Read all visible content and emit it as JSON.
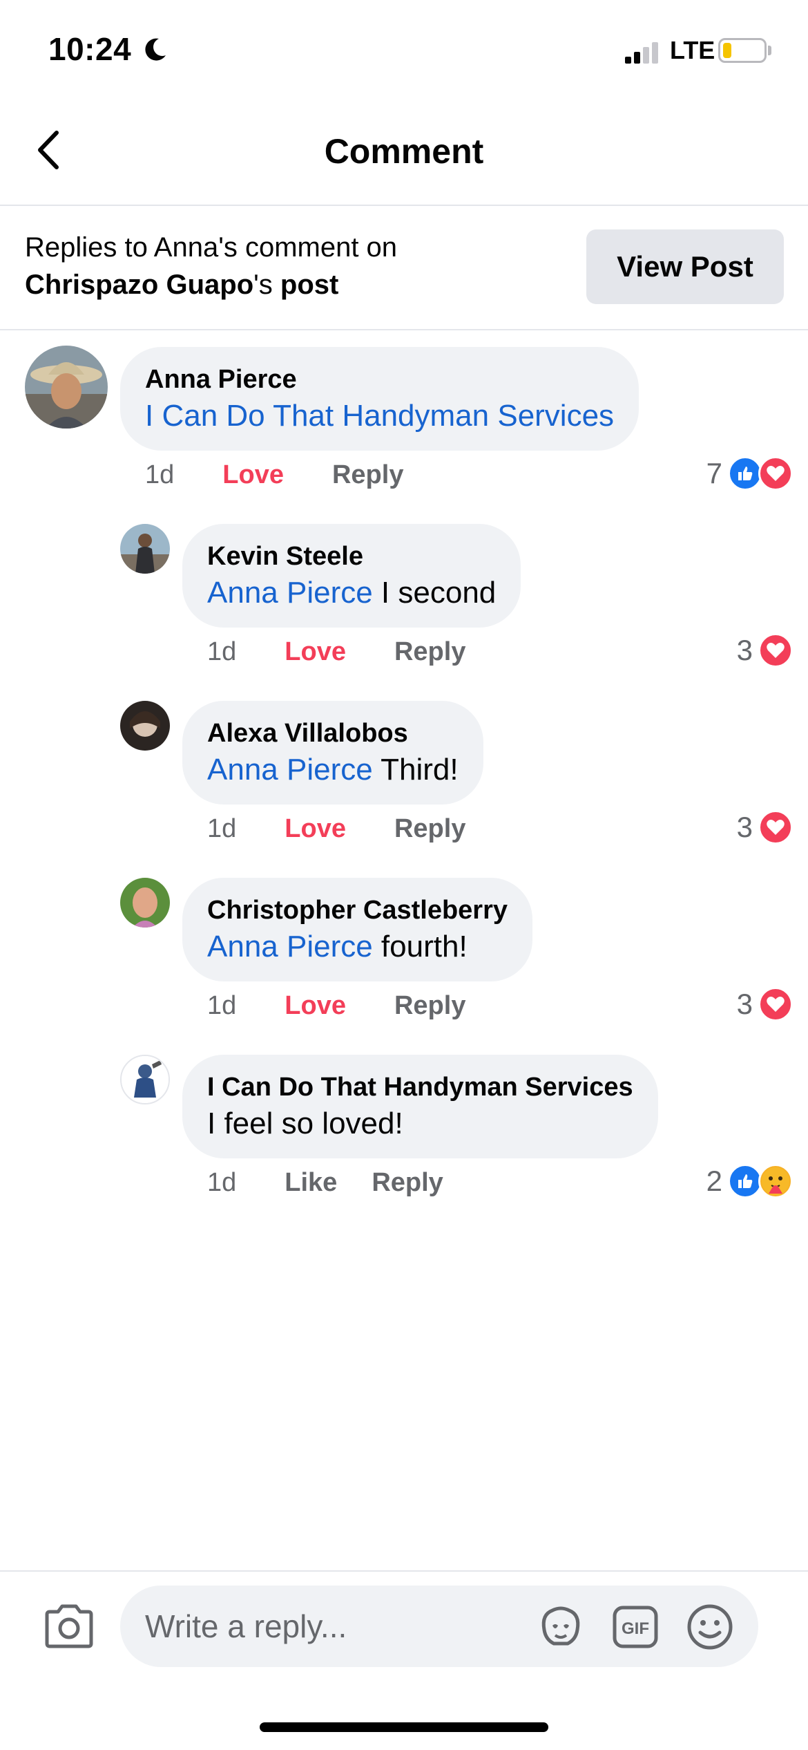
{
  "status_bar": {
    "time": "10:24",
    "network": "LTE"
  },
  "header": {
    "title": "Comment"
  },
  "context": {
    "line1": "Replies to Anna's comment on",
    "post_owner": "Chrispazo Guapo",
    "possessive": "'s",
    "post_word": "post",
    "view_post_label": "View Post"
  },
  "comments": [
    {
      "author": "Anna Pierce",
      "mention": "",
      "text": "I Can Do That Handyman Services",
      "time": "1d",
      "reaction_action": "Love",
      "reply_label": "Reply",
      "reaction_count": "7",
      "reactions": [
        "like-icon",
        "love-icon"
      ]
    },
    {
      "author": "Kevin Steele",
      "mention": "Anna Pierce",
      "text": " I second",
      "time": "1d",
      "reaction_action": "Love",
      "reply_label": "Reply",
      "reaction_count": "3",
      "reactions": [
        "love-icon"
      ]
    },
    {
      "author": "Alexa Villalobos",
      "mention": "Anna Pierce",
      "text": " Third!",
      "time": "1d",
      "reaction_action": "Love",
      "reply_label": "Reply",
      "reaction_count": "3",
      "reactions": [
        "love-icon"
      ]
    },
    {
      "author": "Christopher Castleberry",
      "mention": "Anna Pierce",
      "text": " fourth!",
      "time": "1d",
      "reaction_action": "Love",
      "reply_label": "Reply",
      "reaction_count": "3",
      "reactions": [
        "love-icon"
      ]
    },
    {
      "author": "I Can Do That Handyman Services",
      "mention": "",
      "text": "I feel so loved!",
      "time": "1d",
      "reaction_action": "Like",
      "reply_label": "Reply",
      "reaction_count": "2",
      "reactions": [
        "like-icon",
        "care-icon"
      ]
    }
  ],
  "composer": {
    "placeholder": "Write a reply..."
  },
  "colors": {
    "link": "#1763cf",
    "love": "#f33e58",
    "like": "#1877f2",
    "bubble": "#f0f2f5"
  }
}
